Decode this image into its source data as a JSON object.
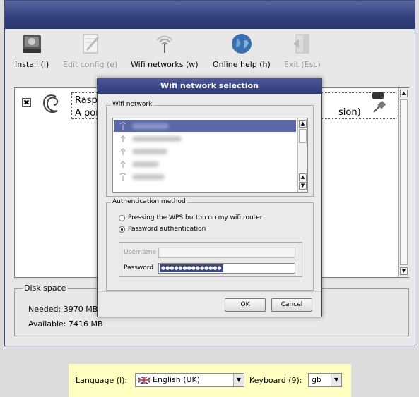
{
  "toolbar": {
    "install": "Install (i)",
    "edit_config": "Edit config (e)",
    "wifi": "Wifi networks (w)",
    "help": "Online help (h)",
    "exit": "Exit (Esc)"
  },
  "os_list": {
    "name": "Raspbia",
    "description": "A port c",
    "description_tail": "sion)"
  },
  "disk": {
    "legend": "Disk space",
    "needed": "Needed: 3970 MB",
    "available": "Available: 7416 MB"
  },
  "dialog": {
    "title": "Wifi network selection",
    "wifi_legend": "Wifi network",
    "auth_legend": "Authentication method",
    "wps_label": "Pressing the WPS button on my wifi router",
    "password_auth_label": "Password authentication",
    "username_label": "Username",
    "password_label": "Password",
    "password_value": "●●●●●●●●●●●●●●",
    "ok": "OK",
    "cancel": "Cancel",
    "selected_auth": "password"
  },
  "lang_bar": {
    "language_label": "Language (l):",
    "language_value": "English (UK)",
    "keyboard_label": "Keyboard (9):",
    "keyboard_value": "gb"
  },
  "colors": {
    "title_bar": "#323f7c",
    "selection": "#5a68a8",
    "lang_bar": "#ffffc2"
  }
}
